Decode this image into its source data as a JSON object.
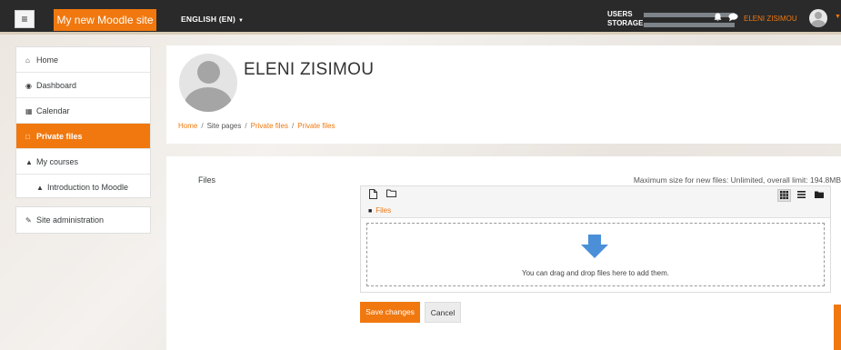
{
  "navbar": {
    "brand": "My new Moodle site",
    "language": "ENGLISH (EN)",
    "usage_users_label": "USERS",
    "usage_storage_label": "STORAGE",
    "user_name": "ELENI ZISIMOU"
  },
  "sidebar": {
    "items": [
      {
        "label": "Home",
        "icon": "home-icon"
      },
      {
        "label": "Dashboard",
        "icon": "dashboard-icon"
      },
      {
        "label": "Calendar",
        "icon": "calendar-icon"
      },
      {
        "label": "Private files",
        "icon": "file-icon"
      },
      {
        "label": "My courses",
        "icon": "graduation-cap-icon"
      },
      {
        "label": "Introduction to Moodle",
        "icon": "graduation-cap-icon"
      }
    ],
    "admin_label": "Site administration"
  },
  "header": {
    "full_name": "ELENI ZISIMOU",
    "breadcrumb": [
      "Home",
      "Site pages",
      "Private files",
      "Private files"
    ]
  },
  "main": {
    "files_label": "Files",
    "max_size": "Maximum size for new files: Unlimited, overall limit: 194.8MB",
    "path_label": "Files",
    "drop_text": "You can drag and drop files here to add them.",
    "save_label": "Save changes",
    "cancel_label": "Cancel"
  },
  "colors": {
    "accent": "#f0780f",
    "navbar": "#2a2a2a",
    "drop_arrow": "#4a8fd8"
  }
}
